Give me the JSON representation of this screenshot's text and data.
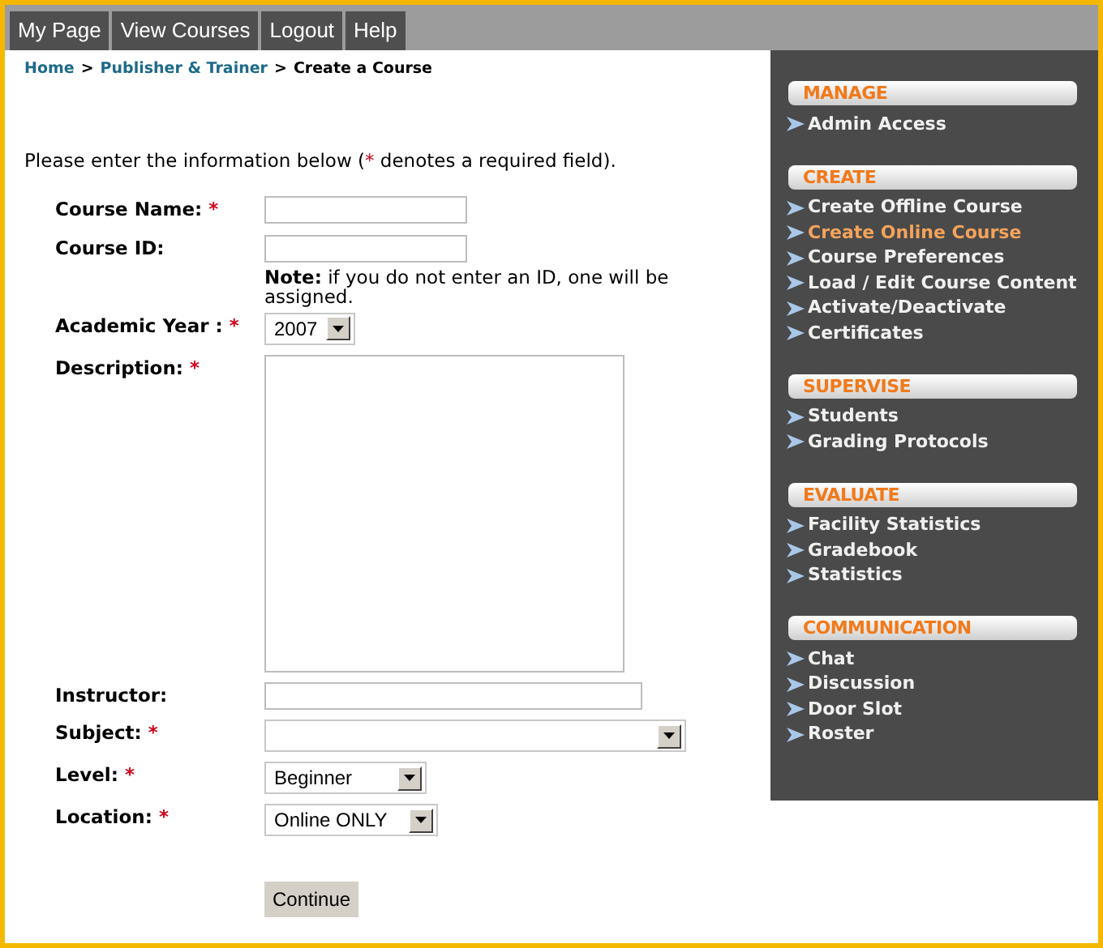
{
  "nav_tabs": [
    {
      "label": "My Page"
    },
    {
      "label": "View Courses"
    },
    {
      "label": "Logout"
    },
    {
      "label": "Help"
    }
  ],
  "breadcrumb": [
    {
      "kind": "link",
      "label": "Home"
    },
    {
      "kind": "separator",
      "label": ">"
    },
    {
      "kind": "link",
      "label": "Publisher & Trainer"
    },
    {
      "kind": "separator",
      "label": ">"
    },
    {
      "kind": "current",
      "label": "Create a Course"
    }
  ],
  "intro": {
    "before": "Please enter the information below (",
    "mark": "*",
    "after": " denotes a required field)."
  },
  "fields": [
    {
      "kind": "text",
      "label": "Course Name:",
      "marker": "*"
    },
    {
      "kind": "text",
      "label": "Course ID:",
      "note": "**Note:** if you do not enter an ID, one will be assigned."
    },
    {
      "kind": "select",
      "label": "Academic Year :",
      "marker": "*",
      "value": "2007"
    },
    {
      "kind": "textarea",
      "label": "Description:",
      "marker": "*"
    },
    {
      "kind": "text",
      "label": "Instructor:"
    },
    {
      "kind": "select",
      "label": "Subject:",
      "marker": "*"
    },
    {
      "kind": "select",
      "label": "Level:",
      "marker": "*",
      "value": "Beginner"
    },
    {
      "kind": "select",
      "label": "Location:",
      "marker": "*",
      "value": "Online ONLY"
    }
  ],
  "submit": {
    "label": "Continue"
  },
  "sidebar": [
    {
      "heading": "MANAGE",
      "items": [
        {
          "label": "Admin Access",
          "selected": false
        }
      ]
    },
    {
      "heading": "CREATE",
      "items": [
        {
          "label": "Create Offline Course",
          "selected": false
        },
        {
          "label": "Create Online Course",
          "selected": true
        },
        {
          "label": "Course Preferences",
          "selected": false
        },
        {
          "label": "Load / Edit Course Content",
          "selected": false
        },
        {
          "label": "Activate/Deactivate",
          "selected": false
        },
        {
          "label": "Certificates",
          "selected": false
        }
      ]
    },
    {
      "heading": "SUPERVISE",
      "items": [
        {
          "label": "Students",
          "selected": false
        },
        {
          "label": "Grading Protocols",
          "selected": false
        }
      ]
    },
    {
      "heading": "EVALUATE",
      "items": [
        {
          "label": "Facility Statistics",
          "selected": false
        },
        {
          "label": "Gradebook",
          "selected": false
        },
        {
          "label": "Statistics",
          "selected": false
        }
      ]
    },
    {
      "heading": "COMMUNICATION",
      "items": [
        {
          "label": "Chat",
          "selected": false
        },
        {
          "label": "Discussion",
          "selected": false
        },
        {
          "label": "Door Slot",
          "selected": false
        },
        {
          "label": "Roster",
          "selected": false
        }
      ]
    }
  ]
}
